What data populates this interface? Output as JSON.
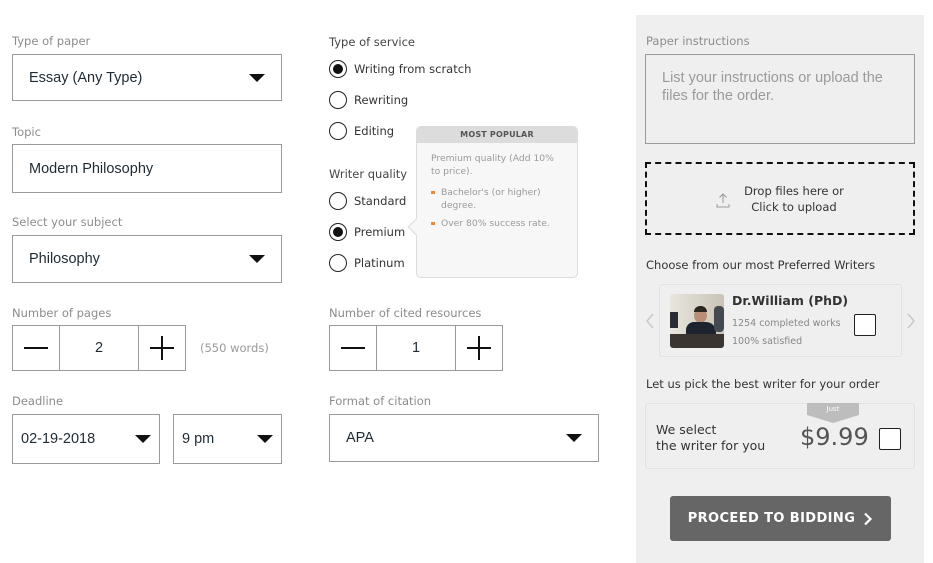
{
  "left_column": {
    "paper_type": {
      "label": "Type of paper",
      "value": "Essay (Any Type)"
    },
    "topic": {
      "label": "Topic",
      "value": "Modern Philosophy"
    },
    "subject": {
      "label": "Select your subject",
      "value": "Philosophy"
    },
    "pages": {
      "label": "Number of pages",
      "value": "2",
      "words_hint": "(550 words)"
    },
    "deadline": {
      "label": "Deadline",
      "date": "02-19-2018",
      "time": "9 pm"
    }
  },
  "middle_column": {
    "service": {
      "label": "Type of service",
      "options": [
        {
          "label": "Writing from scratch",
          "checked": true
        },
        {
          "label": "Rewriting",
          "checked": false
        },
        {
          "label": "Editing",
          "checked": false
        }
      ]
    },
    "quality": {
      "label": "Writer quality",
      "options": [
        {
          "label": "Standard",
          "checked": false
        },
        {
          "label": "Premium",
          "checked": true
        },
        {
          "label": "Platinum",
          "checked": false
        }
      ]
    },
    "tooltip": {
      "header": "MOST POPULAR",
      "description": "Premium quality (Add 10% to price).",
      "bullets": [
        "Bachelor's (or higher) degree.",
        "Over 80% success rate."
      ]
    },
    "cited": {
      "label": "Number of cited resources",
      "value": "1"
    },
    "citation": {
      "label": "Format of citation",
      "value": "APA"
    }
  },
  "right_panel": {
    "instructions": {
      "label": "Paper instructions",
      "placeholder": "List your instructions or upload the files for the order."
    },
    "dropzone": {
      "line1": "Drop files here or",
      "line2": "Click to upload",
      "icon": "upload-icon"
    },
    "preferred": {
      "label": "Choose from our most Preferred Writers",
      "writer": {
        "name": "Dr.William (PhD)",
        "works": "1254 completed works",
        "satisfied": "100% satisfied",
        "selected": false
      }
    },
    "pick": {
      "label": "Let us pick the best writer for your order",
      "badge": "Just",
      "line1": "We select",
      "line2": "the writer for you",
      "price": "$9.99",
      "selected": false
    },
    "proceed_label": "PROCEED TO BIDDING",
    "proceed_icon": "chevron-right-icon"
  },
  "colors": {
    "panel_bg": "#efefef",
    "button_bg": "#666666",
    "bullet_accent": "#e8883a"
  }
}
